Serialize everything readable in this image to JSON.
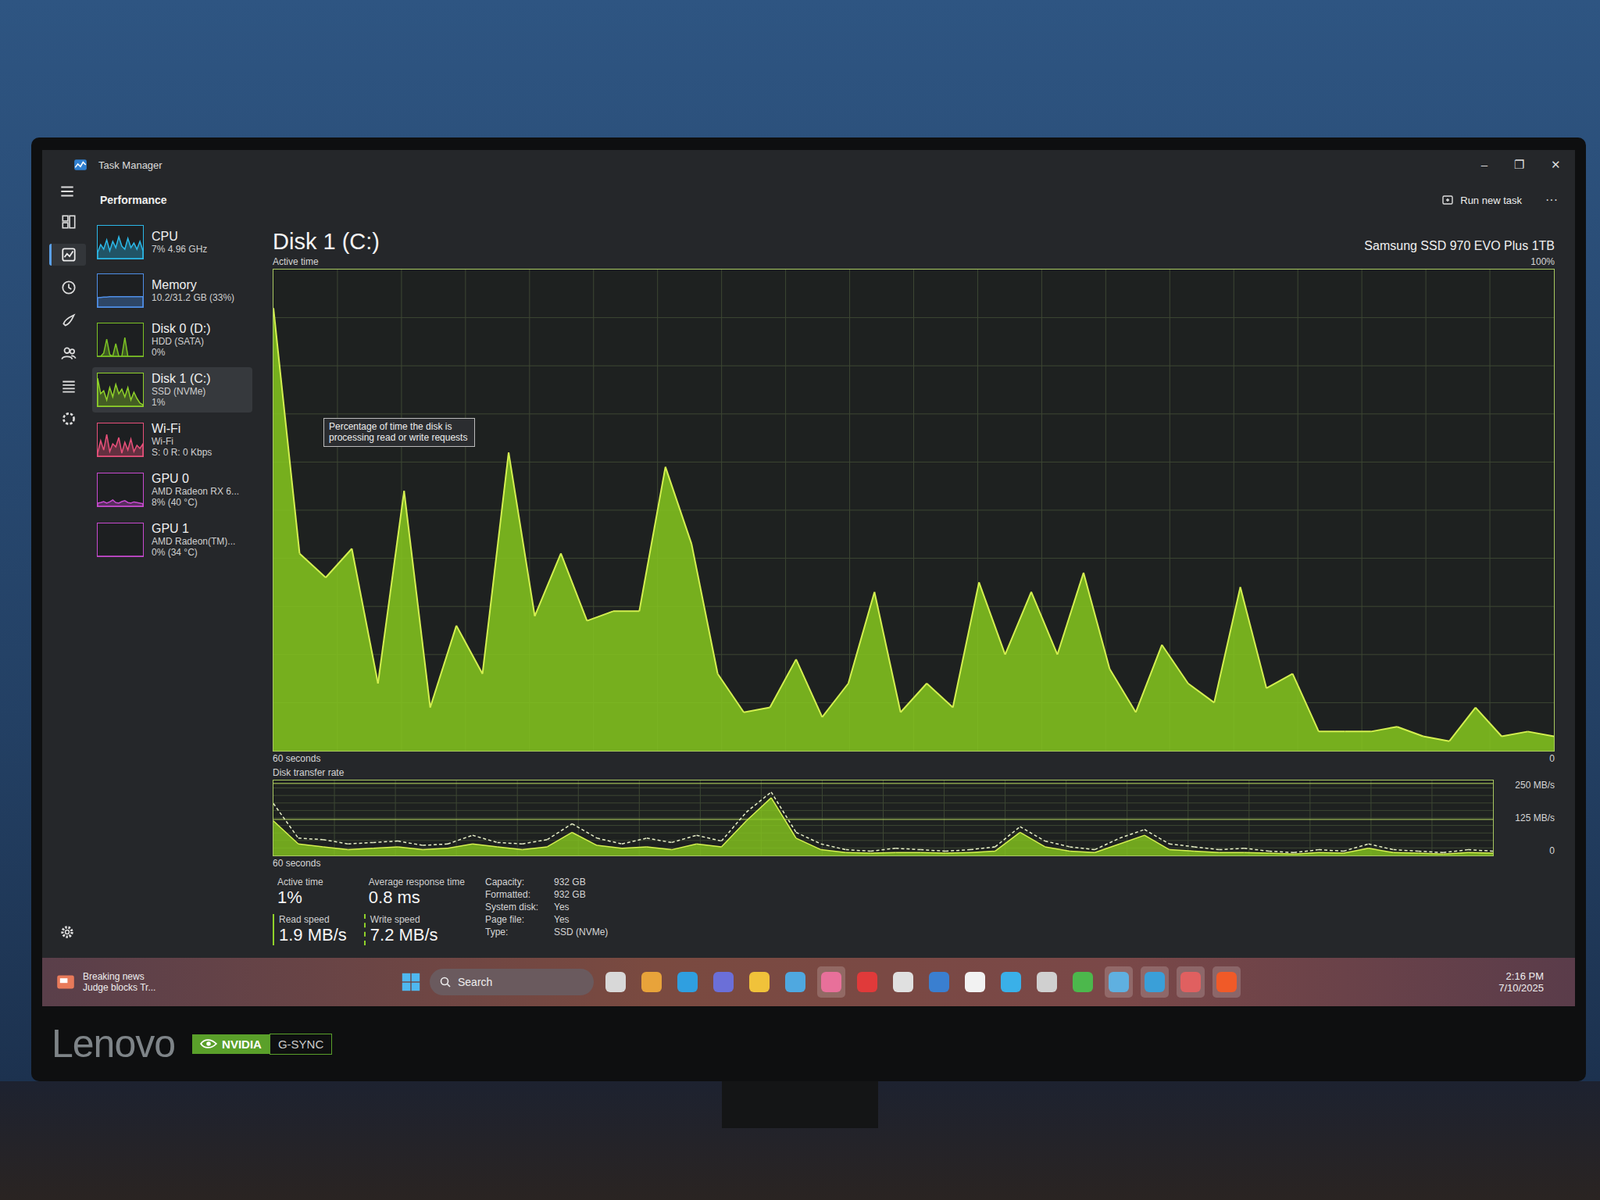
{
  "window": {
    "title": "Task Manager",
    "controls": [
      "–",
      "❐",
      "✕"
    ]
  },
  "page": {
    "title": "Performance",
    "run_new_task": "Run new task",
    "more": "···"
  },
  "nav_rail": [
    {
      "selected": false
    },
    {
      "selected": true
    },
    {
      "selected": false
    },
    {
      "selected": false
    },
    {
      "selected": false
    },
    {
      "selected": false
    },
    {
      "selected": false
    }
  ],
  "sidebar": {
    "items": [
      {
        "name": "CPU",
        "detail": "7% 4.96 GHz",
        "value": "",
        "selected": false,
        "color": "#2bb8e8",
        "values": [
          20,
          45,
          30,
          60,
          25,
          55,
          35,
          70,
          40,
          30,
          65,
          35,
          50,
          30,
          55,
          25
        ]
      },
      {
        "name": "Memory",
        "detail": "10.2/31.2 GB (33%)",
        "value": "",
        "selected": false,
        "color": "#4f8fe8",
        "values": [
          30,
          31,
          32,
          32,
          33,
          33,
          33,
          33,
          33,
          33,
          33,
          33,
          33,
          33,
          33,
          33
        ]
      },
      {
        "name": "Disk 0 (D:)",
        "detail": "HDD (SATA)",
        "value": "0%",
        "selected": false,
        "color": "#7cc225",
        "values": [
          0,
          0,
          10,
          55,
          5,
          0,
          40,
          0,
          0,
          60,
          0,
          0,
          0,
          0,
          0,
          0
        ]
      },
      {
        "name": "Disk 1 (C:)",
        "detail": "SSD (NVMe)",
        "value": "1%",
        "selected": true,
        "color": "#8fd12a",
        "values": [
          90,
          40,
          50,
          20,
          60,
          30,
          70,
          40,
          55,
          30,
          60,
          20,
          45,
          25,
          10,
          5
        ]
      },
      {
        "name": "Wi-Fi",
        "detail": "Wi-Fi",
        "value": "S: 0 R: 0 Kbps",
        "selected": false,
        "color": "#e8507a",
        "values": [
          10,
          50,
          20,
          70,
          15,
          40,
          30,
          60,
          10,
          45,
          20,
          55,
          15,
          35,
          25,
          40
        ]
      },
      {
        "name": "GPU 0",
        "detail": "AMD Radeon RX 6...",
        "value": "8% (40 °C)",
        "selected": false,
        "color": "#c84ad0",
        "values": [
          10,
          12,
          15,
          10,
          14,
          20,
          12,
          10,
          15,
          18,
          12,
          10,
          14,
          12,
          10,
          8
        ]
      },
      {
        "name": "GPU 1",
        "detail": "AMD Radeon(TM)...",
        "value": "0% (34 °C)",
        "selected": false,
        "color": "#c84ad0",
        "values": [
          0,
          0,
          0,
          0,
          0,
          0,
          0,
          0,
          0,
          0,
          0,
          0,
          0,
          0,
          0,
          0
        ]
      }
    ]
  },
  "disk": {
    "title": "Disk 1 (C:)",
    "model": "Samsung SSD 970 EVO Plus 1TB",
    "tooltip": "Percentage of time the disk is processing read or write requests"
  },
  "active_time_chart": {
    "label": "Active time",
    "max_label": "100%",
    "min_label": "0",
    "time_label": "60 seconds",
    "values": [
      92,
      41,
      36,
      42,
      14,
      54,
      9,
      26,
      16,
      62,
      28,
      41,
      27,
      29,
      29,
      59,
      43,
      16,
      8,
      9,
      19,
      7,
      14,
      33,
      8,
      14,
      9,
      35,
      20,
      33,
      20,
      37,
      17,
      8,
      22,
      14,
      10,
      34,
      13,
      16,
      4,
      4,
      4,
      5,
      3,
      2,
      9,
      3,
      4,
      3
    ]
  },
  "transfer_chart": {
    "label": "Disk transfer rate",
    "ticks": [
      "250 MB/s",
      "125 MB/s"
    ],
    "min_label": "0",
    "time_label": "60 seconds",
    "read_values": [
      120,
      40,
      30,
      20,
      25,
      30,
      20,
      25,
      40,
      30,
      20,
      30,
      80,
      35,
      25,
      30,
      20,
      40,
      30,
      120,
      200,
      60,
      20,
      10,
      8,
      10,
      10,
      8,
      10,
      15,
      80,
      30,
      15,
      10,
      40,
      70,
      20,
      15,
      10,
      10,
      8,
      5,
      10,
      8,
      25,
      10,
      8,
      5,
      10,
      8
    ],
    "write_values": [
      180,
      60,
      55,
      40,
      45,
      50,
      35,
      40,
      70,
      45,
      40,
      55,
      110,
      60,
      40,
      60,
      45,
      70,
      50,
      150,
      220,
      80,
      40,
      20,
      15,
      25,
      20,
      15,
      20,
      30,
      100,
      50,
      30,
      20,
      60,
      90,
      40,
      30,
      20,
      25,
      15,
      10,
      20,
      15,
      40,
      20,
      15,
      10,
      20,
      15
    ]
  },
  "stats": [
    {
      "label": "Active time",
      "value": "1%",
      "kind": "plain"
    },
    {
      "label": "Average response time",
      "value": "0.8 ms",
      "kind": "plain"
    },
    {
      "label": "Read speed",
      "value": "1.9 MB/s",
      "kind": "read"
    },
    {
      "label": "Write speed",
      "value": "7.2 MB/s",
      "kind": "write"
    }
  ],
  "properties": [
    {
      "label": "Capacity:",
      "value": "932 GB"
    },
    {
      "label": "Formatted:",
      "value": "932 GB"
    },
    {
      "label": "System disk:",
      "value": "Yes"
    },
    {
      "label": "Page file:",
      "value": "Yes"
    },
    {
      "label": "Type:",
      "value": "SSD (NVMe)"
    }
  ],
  "taskbar": {
    "news_title": "Breaking news",
    "news_text": "Judge blocks Tr...",
    "search": "Search",
    "time": "2:16 PM",
    "date": "7/10/2025",
    "apps": [
      {
        "color": "#d8d8d8",
        "active": false
      },
      {
        "color": "#e8a33a",
        "active": false
      },
      {
        "color": "#2f9fe0",
        "active": false
      },
      {
        "color": "#6b6fd8",
        "active": false
      },
      {
        "color": "#f0c23a",
        "active": false
      },
      {
        "color": "#4fa8e0",
        "active": false
      },
      {
        "color": "#e8709a",
        "active": true
      },
      {
        "color": "#e03a3a",
        "active": false
      },
      {
        "color": "#e0e0e0",
        "active": false
      },
      {
        "color": "#3a7fd0",
        "active": false
      },
      {
        "color": "#f2f2f2",
        "active": false
      },
      {
        "color": "#3ab0e8",
        "active": false
      },
      {
        "color": "#d0d0d0",
        "active": false
      },
      {
        "color": "#4cb84c",
        "active": false
      },
      {
        "color": "#5fb0e0",
        "active": true
      },
      {
        "color": "#3a9fd8",
        "active": true
      },
      {
        "color": "#e06060",
        "active": true
      },
      {
        "color": "#f05a28",
        "active": true
      }
    ]
  },
  "bezel": {
    "brand": "Lenovo",
    "badge": "NVIDIA",
    "badge2": "G-SYNC"
  }
}
